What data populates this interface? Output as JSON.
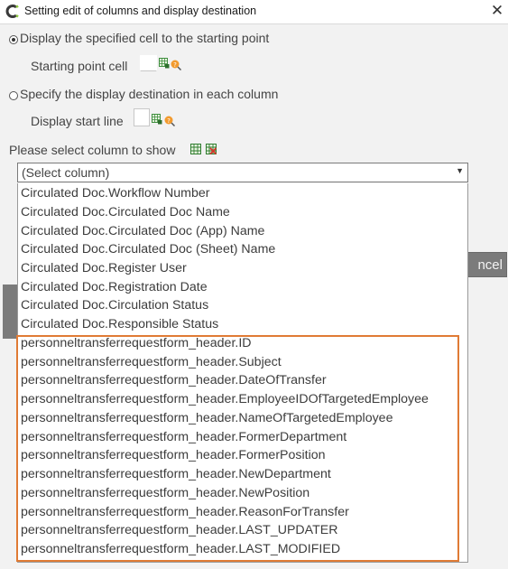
{
  "window": {
    "title": "Setting edit of columns and display destination",
    "close_glyph": "✕"
  },
  "options": {
    "starting_point_radio": "Display the specified cell to the starting point",
    "starting_point_cell_label": "Starting point cell",
    "each_column_radio": "Specify the display destination in each column",
    "display_start_line_label": "Display start line",
    "selected": "starting_point"
  },
  "column_select": {
    "label": "Please select column to show",
    "value": "(Select column)",
    "arrow": "▼"
  },
  "background_button": {
    "label": "ncel"
  },
  "dropdown_items": [
    "Circulated Doc.Workflow Number",
    "Circulated Doc.Circulated Doc Name",
    "Circulated Doc.Circulated Doc (App) Name",
    "Circulated Doc.Circulated Doc (Sheet) Name",
    "Circulated Doc.Register User",
    "Circulated Doc.Registration Date",
    "Circulated Doc.Circulation Status",
    "Circulated Doc.Responsible Status",
    "personneltransferrequestform_header.ID",
    "personneltransferrequestform_header.Subject",
    "personneltransferrequestform_header.DateOfTransfer",
    "personneltransferrequestform_header.EmployeeIDOfTargetedEmployee",
    "personneltransferrequestform_header.NameOfTargetedEmployee",
    "personneltransferrequestform_header.FormerDepartment",
    "personneltransferrequestform_header.FormerPosition",
    "personneltransferrequestform_header.NewDepartment",
    "personneltransferrequestform_header.NewPosition",
    "personneltransferrequestform_header.ReasonForTransfer",
    "personneltransferrequestform_header.LAST_UPDATER",
    "personneltransferrequestform_header.LAST_MODIFIED"
  ],
  "colors": {
    "highlight": "#e07b35",
    "dialog_bg": "#f2f2f2",
    "button_gray": "#7b7b7b"
  },
  "icons": [
    "app-icon",
    "cell-select-icon",
    "help-icon",
    "add-columns-icon",
    "remove-columns-icon",
    "close-icon"
  ]
}
